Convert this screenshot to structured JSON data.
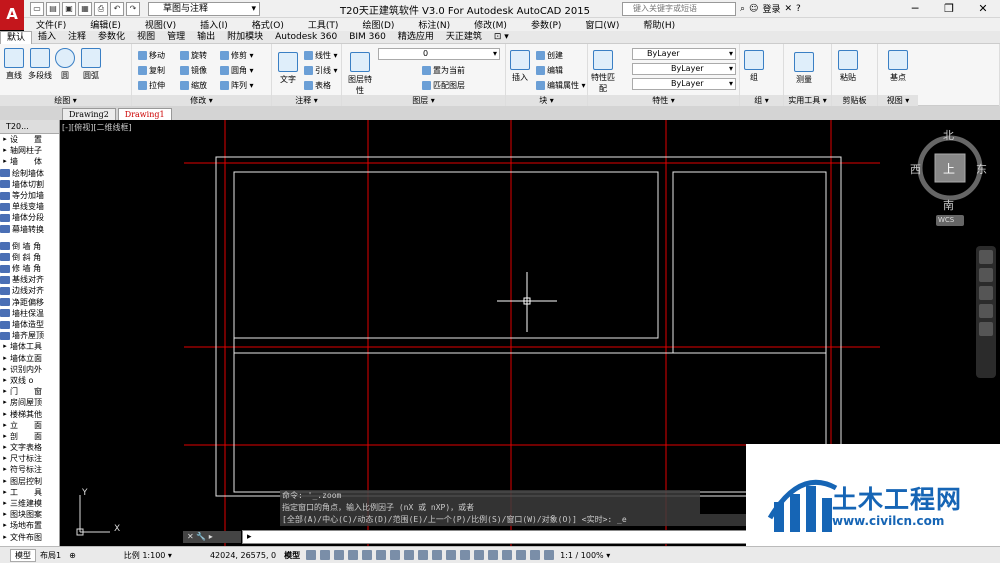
{
  "app": {
    "title": "T20天正建筑软件 V3.0 For Autodesk AutoCAD 2015",
    "logo_letter": "A",
    "workspace": "草图与注释",
    "search_placeholder": "键入关键字或短语",
    "login": "登录",
    "window_buttons": [
      "─",
      "❐",
      "✕"
    ],
    "accent": "#c4161c"
  },
  "menu": [
    "文件(F)",
    "编辑(E)",
    "视图(V)",
    "插入(I)",
    "格式(O)",
    "工具(T)",
    "绘图(D)",
    "标注(N)",
    "修改(M)",
    "参数(P)",
    "窗口(W)",
    "帮助(H)"
  ],
  "ribbon_tabs": [
    "默认",
    "插入",
    "注释",
    "参数化",
    "视图",
    "管理",
    "输出",
    "附加模块",
    "Autodesk 360",
    "BIM 360",
    "精选应用",
    "天正建筑",
    "⊡ ▾"
  ],
  "ribbon": {
    "draw": {
      "caption": "绘图 ▾",
      "big": [
        "直线",
        "多段线",
        "圆",
        "圆弧"
      ]
    },
    "modify": {
      "caption": "修改 ▾",
      "rows": [
        [
          "移动",
          "旋转",
          "修剪 ▾"
        ],
        [
          "复制",
          "镜像",
          "圆角 ▾"
        ],
        [
          "拉伸",
          "缩放",
          "阵列 ▾"
        ]
      ]
    },
    "annotation": {
      "caption": "注释 ▾",
      "big": "文字",
      "small": [
        "线性 ▾",
        "引线 ▾",
        "表格"
      ]
    },
    "layer": {
      "caption": "图层 ▾",
      "big": "图层特性",
      "value": "0",
      "small": [
        "置为当前",
        "匹配图层"
      ]
    },
    "block": {
      "caption": "块 ▾",
      "big": "插入",
      "small": [
        "创建",
        "编辑",
        "编辑属性 ▾"
      ]
    },
    "properties": {
      "caption": "特性 ▾",
      "big": "特性匹配",
      "values": [
        "ByLayer",
        "ByLayer",
        "ByLayer"
      ]
    },
    "group": {
      "caption": "组 ▾",
      "big": "组"
    },
    "utilities": {
      "caption": "实用工具 ▾",
      "big": "测量"
    },
    "clipboard": {
      "caption": "剪贴板",
      "big": "粘贴"
    },
    "view": {
      "caption": "视图 ▾",
      "big": "基点"
    }
  },
  "doc_tabs": [
    "Drawing2",
    "Drawing1"
  ],
  "viewport_label": "[-][俯视][二维线框]",
  "compass": {
    "north": "北",
    "south": "南",
    "east": "东",
    "west": "西",
    "top": "上",
    "wcs": "WCS"
  },
  "sidebar": {
    "header": "T20...",
    "items": [
      {
        "label": "设　　置",
        "type": "cat"
      },
      {
        "label": "轴网柱子",
        "type": "cat"
      },
      {
        "label": "墙　　体",
        "type": "cat"
      },
      {
        "label": "绘制墙体",
        "type": "tool"
      },
      {
        "label": "墙体切割",
        "type": "tool"
      },
      {
        "label": "等分加墙",
        "type": "tool"
      },
      {
        "label": "单线变墙",
        "type": "tool"
      },
      {
        "label": "墙体分段",
        "type": "tool"
      },
      {
        "label": "幕墙转换",
        "type": "tool"
      },
      {
        "label": "",
        "type": "sep"
      },
      {
        "label": "倒 墙 角",
        "type": "tool"
      },
      {
        "label": "倒 斜 角",
        "type": "tool"
      },
      {
        "label": "修 墙 角",
        "type": "tool"
      },
      {
        "label": "基线对齐",
        "type": "tool"
      },
      {
        "label": "边线对齐",
        "type": "tool"
      },
      {
        "label": "净距偏移",
        "type": "tool"
      },
      {
        "label": "墙柱保温",
        "type": "tool"
      },
      {
        "label": "墙体造型",
        "type": "tool"
      },
      {
        "label": "墙齐屋顶",
        "type": "tool"
      },
      {
        "label": "墙体工具",
        "type": "cat"
      },
      {
        "label": "墙体立面",
        "type": "cat"
      },
      {
        "label": "识别内外",
        "type": "cat"
      },
      {
        "label": "双线 o",
        "type": "cat"
      },
      {
        "label": "门　　窗",
        "type": "cat"
      },
      {
        "label": "房间屋顶",
        "type": "cat"
      },
      {
        "label": "楼梯其他",
        "type": "cat"
      },
      {
        "label": "立　　面",
        "type": "cat"
      },
      {
        "label": "剖　　面",
        "type": "cat"
      },
      {
        "label": "文字表格",
        "type": "cat"
      },
      {
        "label": "尺寸标注",
        "type": "cat"
      },
      {
        "label": "符号标注",
        "type": "cat"
      },
      {
        "label": "图层控制",
        "type": "cat"
      },
      {
        "label": "工　　具",
        "type": "cat"
      },
      {
        "label": "三维建模",
        "type": "cat"
      },
      {
        "label": "图块图案",
        "type": "cat"
      },
      {
        "label": "场地布置",
        "type": "cat"
      },
      {
        "label": "文件布图",
        "type": "cat"
      }
    ]
  },
  "command": {
    "history": [
      "命令: '_.zoom",
      "指定窗口的角点，输入比例因子 (nX 或 nXP)，或者",
      "[全部(A)/中心(C)/动态(D)/范围(E)/上一个(P)/比例(S)/窗口(W)/对象(O)] <实时>: _e"
    ],
    "prompt": "▸"
  },
  "ucs": {
    "x": "X",
    "y": "Y"
  },
  "status": {
    "model_tab": "模型",
    "layout_tab": "布局1",
    "scale": "比例 1:100 ▾",
    "coords": "42024, 26575, 0",
    "mode": "模型",
    "annot_scale": "1:1 / 100% ▾"
  },
  "watermark": {
    "title": "土木工程网",
    "url": "www.civilcn.com"
  }
}
